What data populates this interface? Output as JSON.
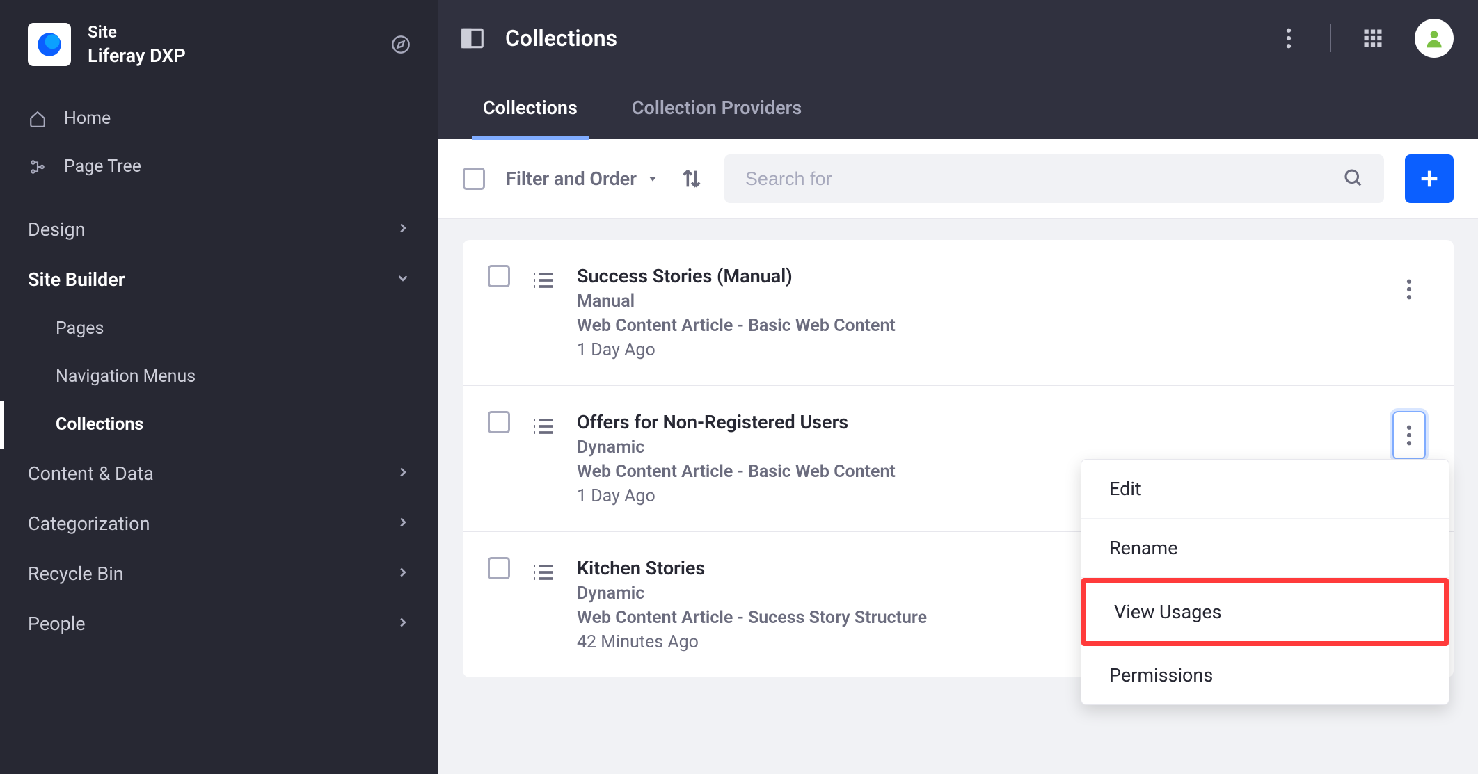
{
  "site": {
    "label": "Site",
    "product": "Liferay DXP"
  },
  "sidebar": {
    "home": "Home",
    "page_tree": "Page Tree",
    "groups": [
      {
        "label": "Design",
        "expanded": false
      },
      {
        "label": "Site Builder",
        "expanded": true,
        "items": [
          "Pages",
          "Navigation Menus",
          "Collections"
        ],
        "active_index": 2
      },
      {
        "label": "Content & Data",
        "expanded": false
      },
      {
        "label": "Categorization",
        "expanded": false
      },
      {
        "label": "Recycle Bin",
        "expanded": false
      },
      {
        "label": "People",
        "expanded": false
      }
    ]
  },
  "header": {
    "title": "Collections"
  },
  "tabs": [
    {
      "label": "Collections",
      "active": true
    },
    {
      "label": "Collection Providers",
      "active": false
    }
  ],
  "toolbar": {
    "filter_label": "Filter and Order",
    "search_placeholder": "Search for"
  },
  "rows": [
    {
      "title": "Success Stories (Manual)",
      "type": "Manual",
      "subtype": "Web Content Article - Basic Web Content",
      "time": "1 Day Ago"
    },
    {
      "title": "Offers for Non-Registered Users",
      "type": "Dynamic",
      "subtype": "Web Content Article - Basic Web Content",
      "time": "1 Day Ago"
    },
    {
      "title": "Kitchen Stories",
      "type": "Dynamic",
      "subtype": "Web Content Article - Sucess Story Structure",
      "time": "42 Minutes Ago"
    }
  ],
  "dropdown": {
    "items": [
      "Edit",
      "Rename",
      "View Usages",
      "Permissions"
    ],
    "highlight_index": 2
  }
}
